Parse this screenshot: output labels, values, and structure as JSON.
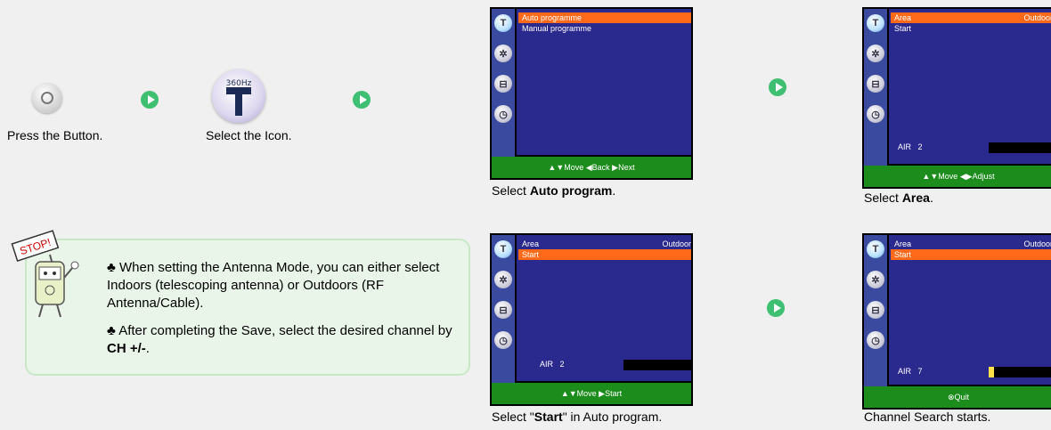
{
  "steps": {
    "press": "Press the Button.",
    "select_icon": "Select the Icon.",
    "icon_label": "360Hz"
  },
  "captions": {
    "auto_prefix": "Select ",
    "auto_bold": "Auto program",
    "auto_suffix": ".",
    "area_prefix": "Select ",
    "area_bold": "Area",
    "area_suffix": ".",
    "start_prefix": "Select \"",
    "start_bold": "Start",
    "start_suffix": "\" in Auto program.",
    "search": "Channel Search starts."
  },
  "screen1": {
    "menu": [
      "Auto programme",
      "Manual programme"
    ],
    "footer": "▲▼Move  ◀Back  ▶Next"
  },
  "screen2": {
    "area_label": "Area",
    "area_value": "Outdoor",
    "start_label": "Start",
    "air_label": "AIR",
    "air_value": "2",
    "footer": "▲▼Move  ◀▶Adjust"
  },
  "screen3": {
    "area_label": "Area",
    "area_value": "Outdoor",
    "start_label": "Start",
    "air_label": "AIR",
    "air_value": "2",
    "footer": "▲▼Move  ▶Start"
  },
  "screen4": {
    "area_label": "Area",
    "area_value": "Outdoor",
    "start_label": "Start",
    "air_label": "AIR",
    "air_value": "7",
    "footer": "⊗Quit"
  },
  "stop_sign": "STOP!",
  "notes": {
    "note1": "When setting the Antenna Mode, you can either select Indoors (telescoping antenna) or Outdoors (RF Antenna/Cable).",
    "note2_prefix": "After completing the Save, select the desired channel by ",
    "note2_bold": "CH +/-",
    "note2_suffix": "."
  },
  "colors": {
    "menu_bg": "#2a2a8e",
    "highlight": "#ff6a1a",
    "footer": "#1c8c1c",
    "arrow": "#3fbf72"
  },
  "icons": [
    "remote-button-icon",
    "antenna-menu-icon",
    "arrow-right-icon",
    "stop-mascot-icon",
    "club-bullet-icon"
  ]
}
